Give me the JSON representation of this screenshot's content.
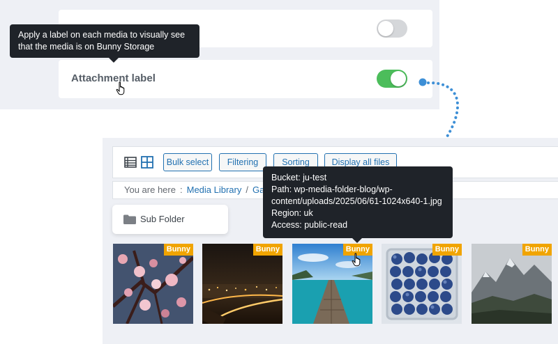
{
  "settings": {
    "tooltip": "Apply a label on each media to visually see that the media is on Bunny Storage",
    "tooltip_line1": "Apply a label on each media to visually see",
    "tooltip_line2": "that the media is on Bunny Storage",
    "row1_toggle": "off",
    "row2_label": "Attachment label",
    "row2_toggle": "on"
  },
  "toolbar": {
    "view_icons": [
      "list-view-icon",
      "grid-view-icon"
    ],
    "bulk_select": "Bulk select",
    "filtering": "Filtering",
    "sorting": "Sorting",
    "display_all": "Display all files"
  },
  "breadcrumb": {
    "prefix": "You are here",
    "separator": ":",
    "root": "Media Library",
    "slash": "/",
    "current": "Galle"
  },
  "folder": {
    "label": "Sub Folder"
  },
  "media_tooltip": {
    "bucket": "Bucket: ju-test",
    "path1": "Path: wp-media-folder-blog/wp-",
    "path2": "content/uploads/2025/06/61-1024x640-1.jpg",
    "region": "Region: uk",
    "access": "Access: public-read"
  },
  "thumbnails": [
    {
      "subject": "cherry-blossom",
      "badge": "Bunny"
    },
    {
      "subject": "night-city",
      "badge": "Bunny"
    },
    {
      "subject": "pier-sea",
      "badge": "Bunny"
    },
    {
      "subject": "blueberries",
      "badge": "Bunny"
    },
    {
      "subject": "mountains",
      "badge": "Bunny"
    }
  ],
  "colors": {
    "toggle_on": "#4cbd5b",
    "toggle_off": "#d5d7da",
    "tooltip_bg": "#1f2329",
    "badge": "#f0a400",
    "link": "#2271b1",
    "arrow": "#3d8fd6"
  }
}
